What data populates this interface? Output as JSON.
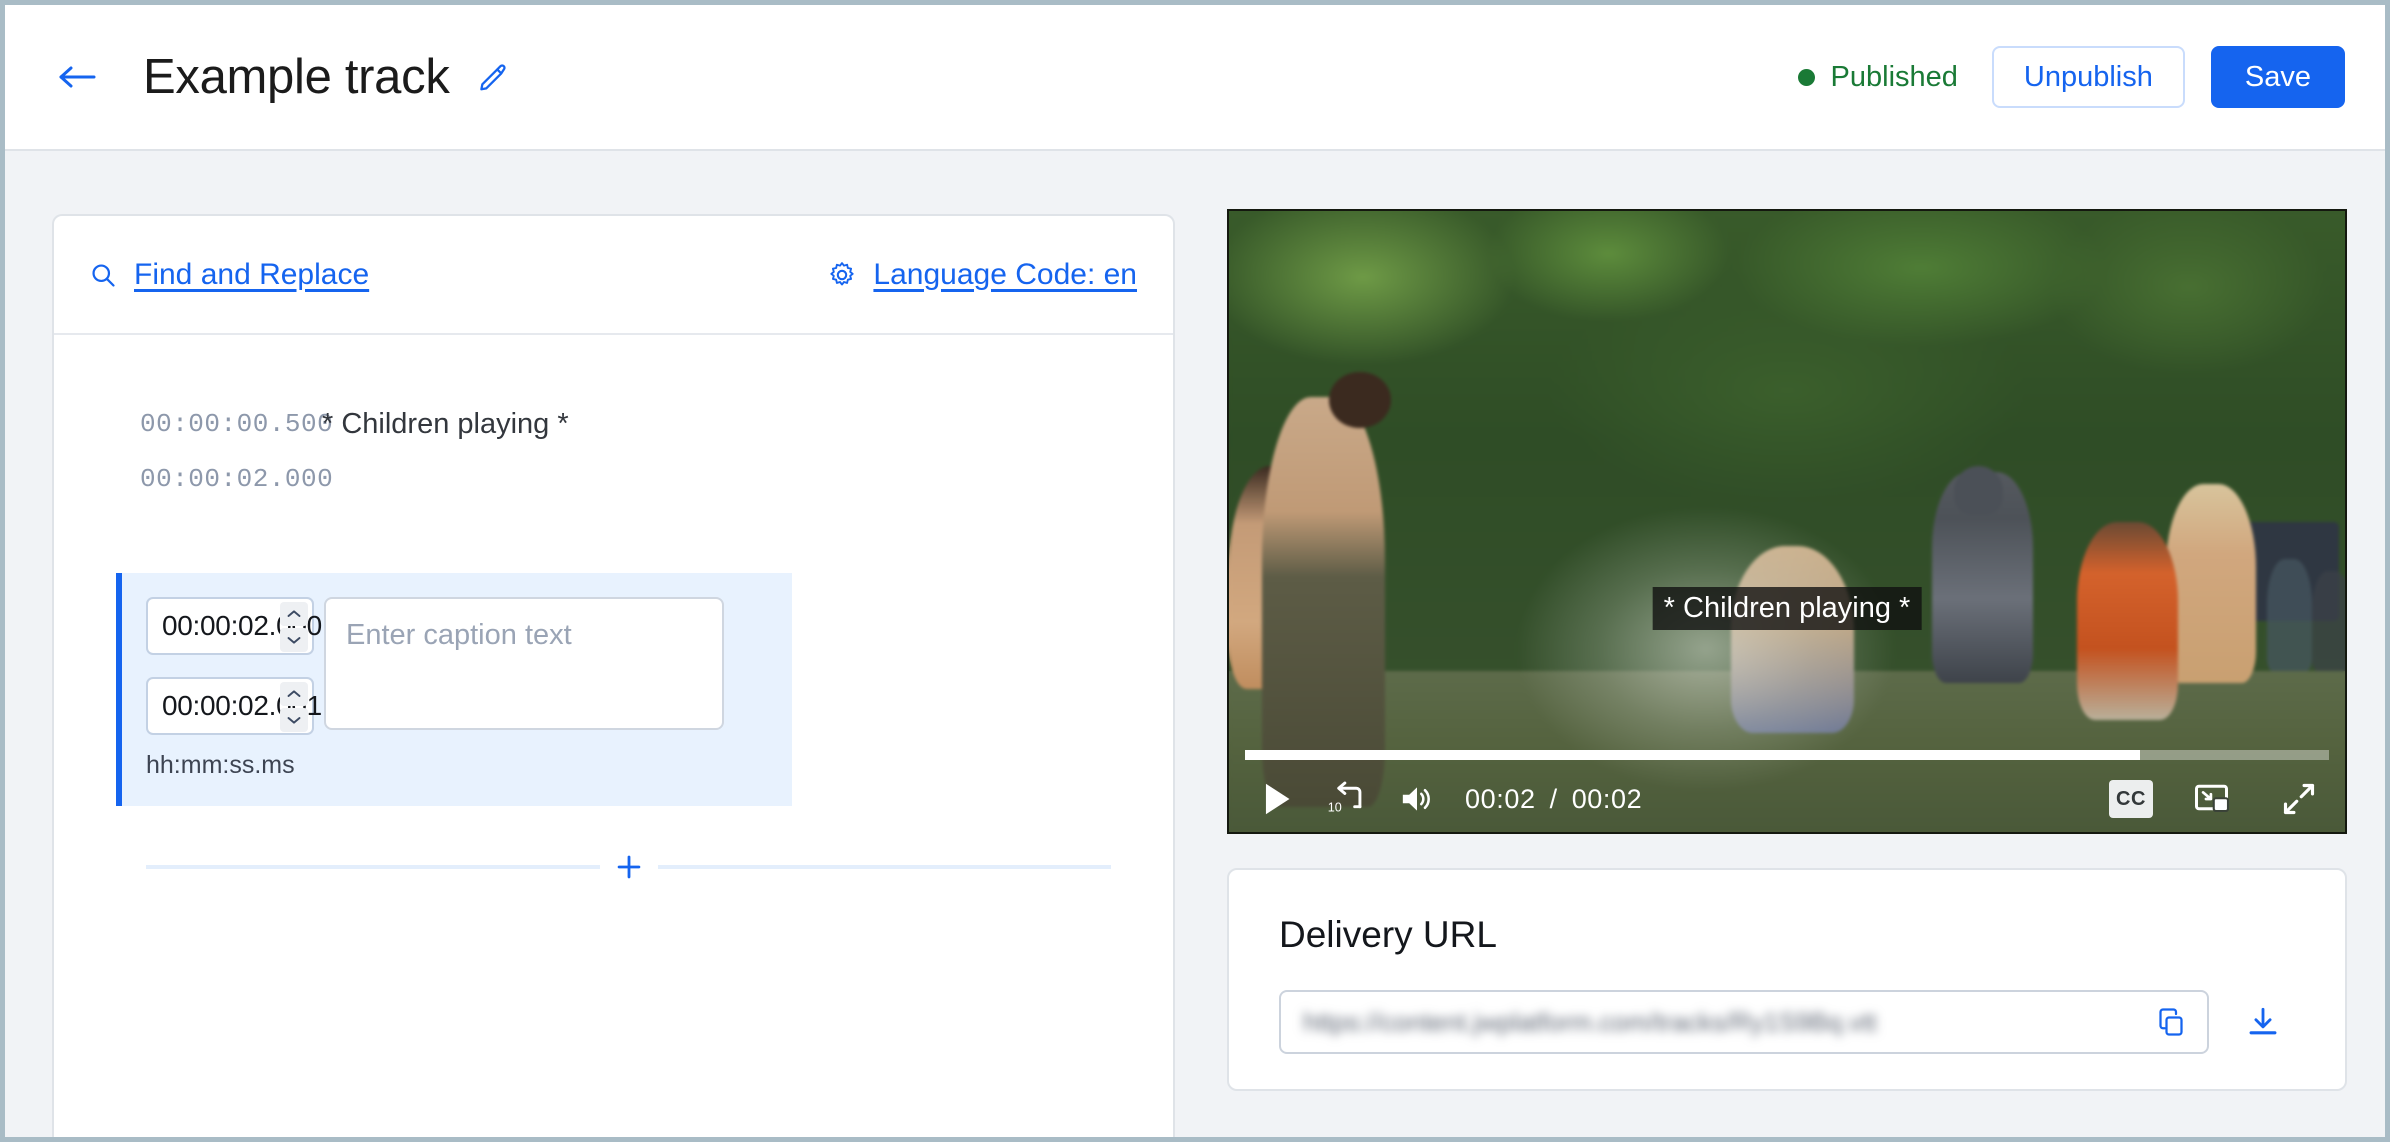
{
  "header": {
    "back_icon": "arrow-left-icon",
    "title": "Example track",
    "edit_icon": "pencil-icon",
    "status_label": "Published",
    "status_color": "#1a7a36",
    "unpublish_label": "Unpublish",
    "save_label": "Save",
    "accent_color": "#1564ef"
  },
  "editor": {
    "find_replace_icon": "search-icon",
    "find_replace_label": "Find and Replace",
    "language_icon": "gear-icon",
    "language_label": "Language Code: en",
    "cues": [
      {
        "start": "00:00:00.500",
        "end": "00:00:02.000",
        "text": "* Children playing *"
      }
    ],
    "active_cue": {
      "start_value": "00:00:02.000",
      "end_value": "00:00:02.001",
      "format_hint": "hh:mm:ss.ms",
      "text_value": "",
      "text_placeholder": "Enter caption text",
      "stepper_up_icon": "chevron-up-icon",
      "stepper_down_icon": "chevron-down-icon"
    },
    "add_cue_icon": "plus-icon"
  },
  "player": {
    "caption_overlay": "* Children playing *",
    "play_icon": "play-icon",
    "rewind_icon": "rewind-10-icon",
    "rewind_label": "10",
    "volume_icon": "volume-icon",
    "current_time": "00:02",
    "time_separator": "/",
    "duration": "00:02",
    "cc_label": "CC",
    "cc_icon": "closed-captions-icon",
    "pip_icon": "picture-in-picture-icon",
    "fullscreen_icon": "fullscreen-icon",
    "progress_percent": 82.6
  },
  "delivery": {
    "title": "Delivery URL",
    "url_value": "https://content.jwplatform.com/tracks/Ry1S9Bq.vtt",
    "copy_icon": "copy-icon",
    "download_icon": "download-icon"
  }
}
